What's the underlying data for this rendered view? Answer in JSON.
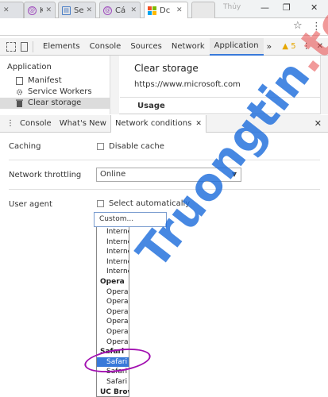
{
  "browser": {
    "tabs": [
      {
        "label": "Kế",
        "icon": "at-icon"
      },
      {
        "label": "Se",
        "icon": "document-icon"
      },
      {
        "label": "Cá",
        "icon": "at-icon"
      },
      {
        "label": "Dc",
        "icon": "microsoft-logo-icon"
      }
    ],
    "profile_name": "Thủy",
    "colors": {
      "ms_red": "#f25022",
      "ms_green": "#7fba00",
      "ms_blue": "#00a4ef",
      "ms_yellow": "#ffb900"
    }
  },
  "devtools": {
    "tabs": [
      "Elements",
      "Console",
      "Sources",
      "Network",
      "Application"
    ],
    "active_tab": "Application",
    "more_label": "»",
    "warning_count": "5",
    "accent_color": "#3879d9"
  },
  "application": {
    "section_title": "Application",
    "items": [
      "Manifest",
      "Service Workers",
      "Clear storage"
    ],
    "selected": "Clear storage",
    "main_title": "Clear storage",
    "origin": "https://www.microsoft.com",
    "usage_heading": "Usage"
  },
  "drawer": {
    "tabs": [
      "Console",
      "What's New",
      "Network conditions"
    ],
    "active_tab": "Network conditions"
  },
  "network_conditions": {
    "caching_label": "Caching",
    "disable_cache_label": "Disable cache",
    "throttling_label": "Network throttling",
    "throttling_value": "Online",
    "user_agent_label": "User agent",
    "select_auto_label": "Select automatically",
    "ua_value": "Custom...",
    "ua_options": [
      {
        "type": "option",
        "text": "Interne"
      },
      {
        "type": "option",
        "text": "Interne"
      },
      {
        "type": "option",
        "text": "Interne"
      },
      {
        "type": "option",
        "text": "Interne"
      },
      {
        "type": "option",
        "text": "Interne"
      },
      {
        "type": "group",
        "text": "Opera"
      },
      {
        "type": "option",
        "text": "Opera"
      },
      {
        "type": "option",
        "text": "Opera"
      },
      {
        "type": "option",
        "text": "Opera"
      },
      {
        "type": "option",
        "text": "Opera"
      },
      {
        "type": "option",
        "text": "Opera"
      },
      {
        "type": "option",
        "text": "Opera"
      },
      {
        "type": "group",
        "text": "Safari"
      },
      {
        "type": "option",
        "text": "Safari -",
        "highlighted": true
      },
      {
        "type": "option",
        "text": "Safari -"
      },
      {
        "type": "option",
        "text": "Safari -"
      },
      {
        "type": "group",
        "text": "UC Brow"
      }
    ]
  },
  "watermark": {
    "text": "Truongtin",
    "tld": ".top"
  }
}
